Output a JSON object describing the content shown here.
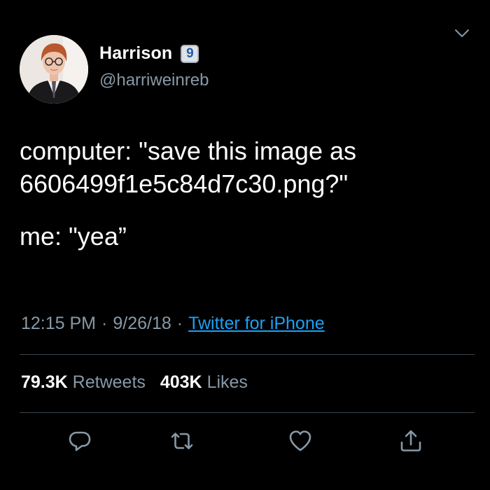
{
  "author": {
    "display_name": "Harrison",
    "badge": "9",
    "handle": "@harriweinreb"
  },
  "tweet": {
    "lines": [
      "computer: \"save this image as",
      "6606499f1e5c84d7c30.png?\""
    ],
    "reply_line": "me: \"yea”"
  },
  "meta": {
    "time": "12:15 PM",
    "separator": "·",
    "date": "9/26/18",
    "source": "Twitter for iPhone"
  },
  "stats": {
    "retweets_value": "79.3K",
    "retweets_label": "Retweets",
    "likes_value": "403K",
    "likes_label": "Likes"
  },
  "actions": [
    "reply-icon",
    "retweet-icon",
    "like-icon",
    "share-icon"
  ],
  "icons": {
    "menu": "chevron-down-icon"
  },
  "colors": {
    "background": "#000000",
    "primary_text": "#ffffff",
    "secondary_text": "#8899a6",
    "link": "#1da1f2",
    "divider": "#38444d"
  }
}
